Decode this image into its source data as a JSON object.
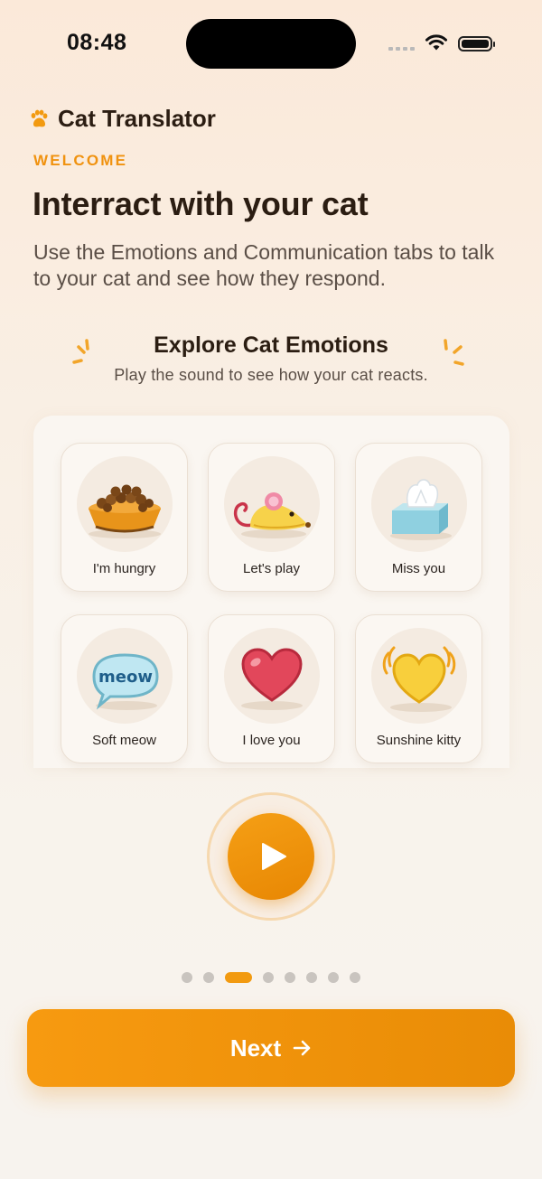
{
  "status_bar": {
    "time": "08:48"
  },
  "header": {
    "app_name": "Cat Translator",
    "eyebrow": "WELCOME"
  },
  "main": {
    "title": "Interract with your cat",
    "subtitle": "Use the Emotions and Communication tabs to talk to your cat and see how they respond.",
    "section_title": "Explore Cat Emotions",
    "section_subtitle": "Play the sound to see how your cat reacts.",
    "tiles": [
      {
        "label": "I'm hungry",
        "icon": "food-bowl-icon"
      },
      {
        "label": "Let's play",
        "icon": "toy-mouse-icon"
      },
      {
        "label": "Miss you",
        "icon": "tissue-box-icon"
      },
      {
        "label": "Soft meow",
        "icon": "meow-bubble-icon",
        "icon_text": "meow"
      },
      {
        "label": "I love you",
        "icon": "red-heart-icon"
      },
      {
        "label": "Sunshine kitty",
        "icon": "yellow-heart-icon"
      }
    ]
  },
  "pager": {
    "total": 8,
    "active_index": 2
  },
  "footer": {
    "next_label": "Next"
  },
  "colors": {
    "accent": "#F29A10",
    "title": "#2B1D12",
    "body": "#5A4E46"
  }
}
